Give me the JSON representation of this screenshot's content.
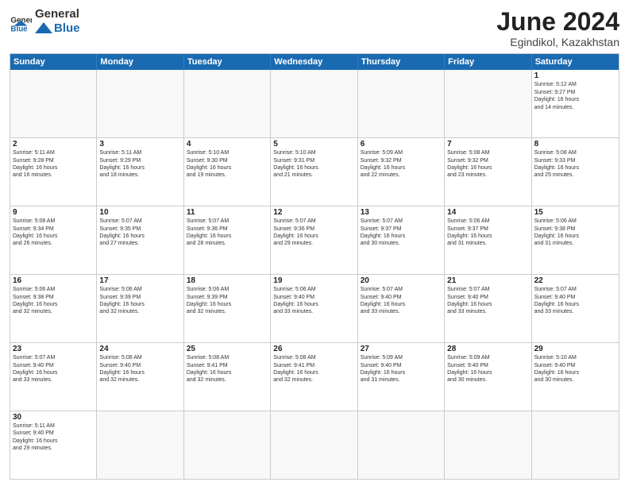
{
  "header": {
    "logo_general": "General",
    "logo_blue": "Blue",
    "title": "June 2024",
    "subtitle": "Egindikol, Kazakhstan"
  },
  "weekdays": [
    "Sunday",
    "Monday",
    "Tuesday",
    "Wednesday",
    "Thursday",
    "Friday",
    "Saturday"
  ],
  "rows": [
    [
      {
        "day": "",
        "info": ""
      },
      {
        "day": "",
        "info": ""
      },
      {
        "day": "",
        "info": ""
      },
      {
        "day": "",
        "info": ""
      },
      {
        "day": "",
        "info": ""
      },
      {
        "day": "",
        "info": ""
      },
      {
        "day": "1",
        "info": "Sunrise: 5:12 AM\nSunset: 9:27 PM\nDaylight: 16 hours\nand 14 minutes."
      }
    ],
    [
      {
        "day": "2",
        "info": "Sunrise: 5:11 AM\nSunset: 9:28 PM\nDaylight: 16 hours\nand 16 minutes."
      },
      {
        "day": "3",
        "info": "Sunrise: 5:11 AM\nSunset: 9:29 PM\nDaylight: 16 hours\nand 18 minutes."
      },
      {
        "day": "4",
        "info": "Sunrise: 5:10 AM\nSunset: 9:30 PM\nDaylight: 16 hours\nand 19 minutes."
      },
      {
        "day": "5",
        "info": "Sunrise: 5:10 AM\nSunset: 9:31 PM\nDaylight: 16 hours\nand 21 minutes."
      },
      {
        "day": "6",
        "info": "Sunrise: 5:09 AM\nSunset: 9:32 PM\nDaylight: 16 hours\nand 22 minutes."
      },
      {
        "day": "7",
        "info": "Sunrise: 5:08 AM\nSunset: 9:32 PM\nDaylight: 16 hours\nand 23 minutes."
      },
      {
        "day": "8",
        "info": "Sunrise: 5:08 AM\nSunset: 9:33 PM\nDaylight: 16 hours\nand 25 minutes."
      }
    ],
    [
      {
        "day": "9",
        "info": "Sunrise: 5:08 AM\nSunset: 9:34 PM\nDaylight: 16 hours\nand 26 minutes."
      },
      {
        "day": "10",
        "info": "Sunrise: 5:07 AM\nSunset: 9:35 PM\nDaylight: 16 hours\nand 27 minutes."
      },
      {
        "day": "11",
        "info": "Sunrise: 5:07 AM\nSunset: 9:36 PM\nDaylight: 16 hours\nand 28 minutes."
      },
      {
        "day": "12",
        "info": "Sunrise: 5:07 AM\nSunset: 9:36 PM\nDaylight: 16 hours\nand 29 minutes."
      },
      {
        "day": "13",
        "info": "Sunrise: 5:07 AM\nSunset: 9:37 PM\nDaylight: 16 hours\nand 30 minutes."
      },
      {
        "day": "14",
        "info": "Sunrise: 5:06 AM\nSunset: 9:37 PM\nDaylight: 16 hours\nand 31 minutes."
      },
      {
        "day": "15",
        "info": "Sunrise: 5:06 AM\nSunset: 9:38 PM\nDaylight: 16 hours\nand 31 minutes."
      }
    ],
    [
      {
        "day": "16",
        "info": "Sunrise: 5:06 AM\nSunset: 9:38 PM\nDaylight: 16 hours\nand 32 minutes."
      },
      {
        "day": "17",
        "info": "Sunrise: 5:06 AM\nSunset: 9:39 PM\nDaylight: 16 hours\nand 32 minutes."
      },
      {
        "day": "18",
        "info": "Sunrise: 5:06 AM\nSunset: 9:39 PM\nDaylight: 16 hours\nand 32 minutes."
      },
      {
        "day": "19",
        "info": "Sunrise: 5:06 AM\nSunset: 9:40 PM\nDaylight: 16 hours\nand 33 minutes."
      },
      {
        "day": "20",
        "info": "Sunrise: 5:07 AM\nSunset: 9:40 PM\nDaylight: 16 hours\nand 33 minutes."
      },
      {
        "day": "21",
        "info": "Sunrise: 5:07 AM\nSunset: 9:40 PM\nDaylight: 16 hours\nand 33 minutes."
      },
      {
        "day": "22",
        "info": "Sunrise: 5:07 AM\nSunset: 9:40 PM\nDaylight: 16 hours\nand 33 minutes."
      }
    ],
    [
      {
        "day": "23",
        "info": "Sunrise: 5:07 AM\nSunset: 9:40 PM\nDaylight: 16 hours\nand 33 minutes."
      },
      {
        "day": "24",
        "info": "Sunrise: 5:08 AM\nSunset: 9:40 PM\nDaylight: 16 hours\nand 32 minutes."
      },
      {
        "day": "25",
        "info": "Sunrise: 5:08 AM\nSunset: 9:41 PM\nDaylight: 16 hours\nand 32 minutes."
      },
      {
        "day": "26",
        "info": "Sunrise: 5:08 AM\nSunset: 9:41 PM\nDaylight: 16 hours\nand 32 minutes."
      },
      {
        "day": "27",
        "info": "Sunrise: 5:09 AM\nSunset: 9:40 PM\nDaylight: 16 hours\nand 31 minutes."
      },
      {
        "day": "28",
        "info": "Sunrise: 5:09 AM\nSunset: 9:40 PM\nDaylight: 16 hours\nand 30 minutes."
      },
      {
        "day": "29",
        "info": "Sunrise: 5:10 AM\nSunset: 9:40 PM\nDaylight: 16 hours\nand 30 minutes."
      }
    ],
    [
      {
        "day": "30",
        "info": "Sunrise: 5:11 AM\nSunset: 9:40 PM\nDaylight: 16 hours\nand 29 minutes."
      },
      {
        "day": "",
        "info": ""
      },
      {
        "day": "",
        "info": ""
      },
      {
        "day": "",
        "info": ""
      },
      {
        "day": "",
        "info": ""
      },
      {
        "day": "",
        "info": ""
      },
      {
        "day": "",
        "info": ""
      }
    ]
  ]
}
